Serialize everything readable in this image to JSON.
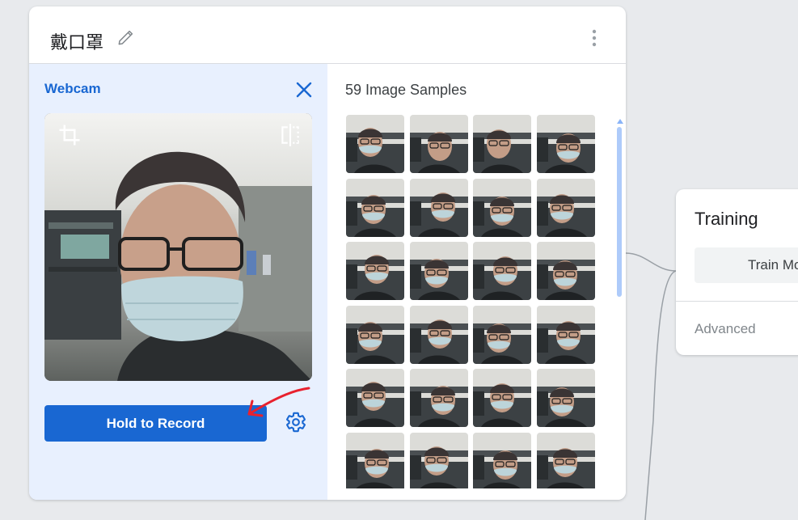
{
  "class_card": {
    "name": "戴口罩",
    "webcam": {
      "title": "Webcam",
      "record_button_label": "Hold to Record"
    },
    "samples": {
      "title": "59 Image Samples",
      "thumbnail_count_visible": 24
    }
  },
  "training": {
    "title": "Training",
    "train_button_label": "Train Model",
    "advanced_label": "Advanced"
  },
  "icons": [
    "edit-icon",
    "more-vert-icon",
    "close-icon",
    "crop-icon",
    "flip-icon",
    "settings-icon"
  ],
  "colors": {
    "accent": "#1967d2",
    "panel_bg": "#e8f0fe",
    "page_bg": "#e8eaed",
    "annotation": "#e8212e"
  }
}
